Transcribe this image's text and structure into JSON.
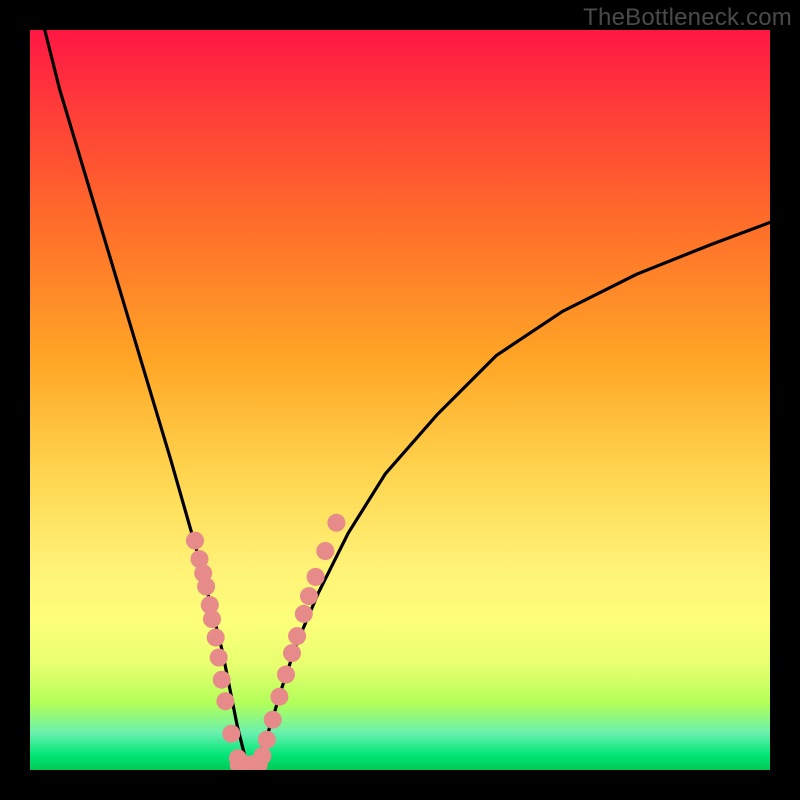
{
  "watermark": {
    "text": "TheBottleneck.com"
  },
  "colors": {
    "curve_stroke": "#000000",
    "dot_fill": "#e68a8a",
    "dot_stroke": "rgba(0,0,0,0)"
  },
  "chart_data": {
    "type": "line",
    "title": "",
    "xlabel": "",
    "ylabel": "",
    "xlim": [
      0,
      100
    ],
    "ylim": [
      0,
      100
    ],
    "note": "No numeric axes are shown; x/y values are estimated from pixel positions as fractions of the plot area (0–100).",
    "series": [
      {
        "name": "bottleneck-curve",
        "kind": "line",
        "x": [
          2,
          4,
          7,
          10,
          13,
          16,
          19,
          21,
          23,
          24.5,
          26,
          27,
          28,
          29,
          30,
          31,
          32.5,
          34,
          36,
          39,
          43,
          48,
          55,
          63,
          72,
          82,
          92,
          100
        ],
        "y": [
          100,
          92,
          82,
          72,
          62,
          52,
          42,
          35,
          28,
          22,
          16,
          11,
          6,
          2,
          0.5,
          2,
          6,
          11,
          17,
          24,
          32,
          40,
          48,
          56,
          62,
          67,
          71,
          74
        ]
      },
      {
        "name": "left-cluster-dots",
        "kind": "scatter",
        "x": [
          22.3,
          22.9,
          23.4,
          23.8,
          24.3,
          24.6,
          25.1,
          25.5,
          25.9,
          26.4,
          27.2,
          28.1,
          29.0
        ],
        "y": [
          31.0,
          28.5,
          26.6,
          24.8,
          22.3,
          20.4,
          17.9,
          15.2,
          12.2,
          9.3,
          4.9,
          1.6,
          0.8
        ]
      },
      {
        "name": "right-cluster-dots",
        "kind": "scatter",
        "x": [
          30.1,
          31.4,
          32.0,
          32.8,
          33.7,
          34.6,
          35.4,
          36.1,
          37.0,
          37.7,
          38.6,
          39.9,
          41.4
        ],
        "y": [
          0.8,
          1.9,
          4.1,
          6.8,
          9.9,
          12.9,
          15.8,
          18.1,
          21.1,
          23.5,
          26.1,
          29.6,
          33.4
        ]
      },
      {
        "name": "bottom-bridge-dots",
        "kind": "scatter",
        "x": [
          28.2,
          29.1,
          30.0,
          30.9
        ],
        "y": [
          0.7,
          0.6,
          0.6,
          0.7
        ]
      }
    ]
  }
}
